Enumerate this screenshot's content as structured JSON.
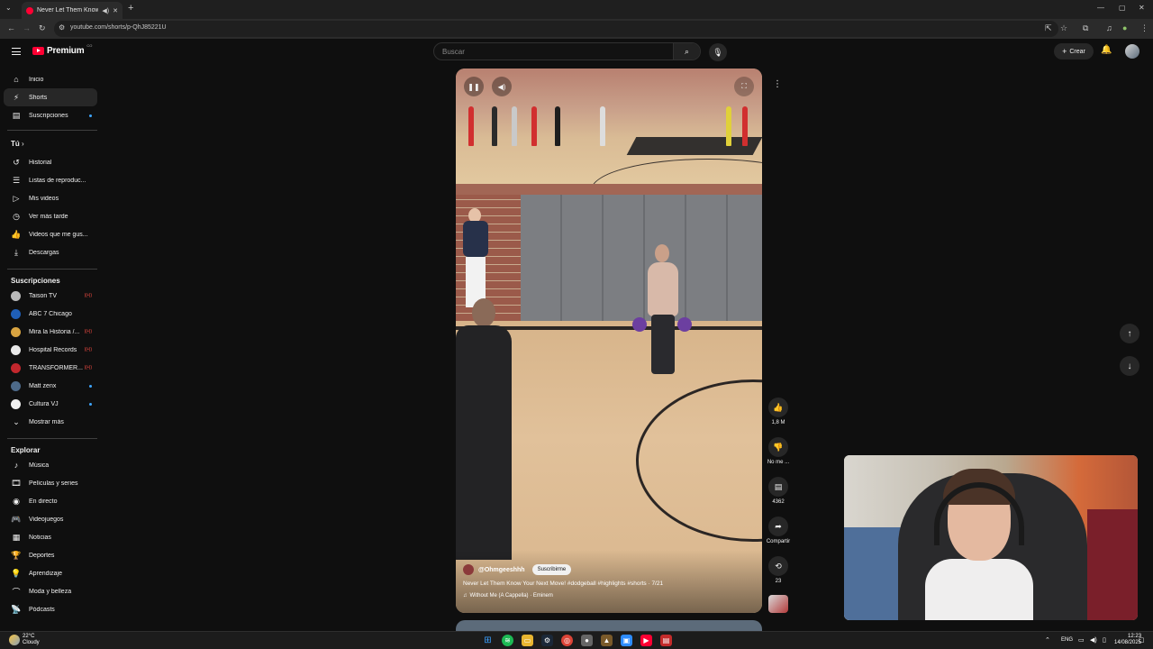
{
  "browser": {
    "tab_title": "Never Let Them Know Your",
    "url": "youtube.com/shorts/p-QhJ85221U",
    "colors": {
      "tab_favicon": "#ff0033"
    }
  },
  "header": {
    "logo_text": "Premium",
    "logo_sup": "CO",
    "search_placeholder": "Buscar",
    "create_label": "Crear"
  },
  "sidebar": {
    "main": [
      {
        "label": "Inicio",
        "icon": "home-icon"
      },
      {
        "label": "Shorts",
        "icon": "shorts-icon",
        "active": true
      },
      {
        "label": "Suscripciones",
        "icon": "subscriptions-icon"
      }
    ],
    "you_heading": "Tú",
    "you": [
      {
        "label": "Historial",
        "icon": "history-icon"
      },
      {
        "label": "Listas de reproduc...",
        "icon": "playlist-icon"
      },
      {
        "label": "Mis videos",
        "icon": "my-videos-icon"
      },
      {
        "label": "Ver más tarde",
        "icon": "watch-later-icon"
      },
      {
        "label": "Videos que me gus...",
        "icon": "liked-icon"
      },
      {
        "label": "Descargas",
        "icon": "download-icon"
      }
    ],
    "subs_heading": "Suscripciones",
    "subs": [
      {
        "label": "Taison TV",
        "color": "#b9b9b9"
      },
      {
        "label": "ABC 7 Chicago",
        "color": "#1f5fb8"
      },
      {
        "label": "Mira la Historia /...",
        "color": "#d9a441"
      },
      {
        "label": "Hospital Records",
        "color": "#e9e9e9"
      },
      {
        "label": "TRANSFORMER...",
        "color": "#c2272d"
      },
      {
        "label": "Matt zenx",
        "color": "#4d6a8a"
      },
      {
        "label": "Cultura VJ",
        "color": "#f0f0f0"
      }
    ],
    "show_more": "Mostrar más",
    "explore_heading": "Explorar",
    "explore": [
      {
        "label": "Música",
        "icon": "music-icon"
      },
      {
        "label": "Películas y series",
        "icon": "movies-icon"
      },
      {
        "label": "En directo",
        "icon": "live-icon"
      },
      {
        "label": "Videojuegos",
        "icon": "gaming-icon"
      },
      {
        "label": "Noticias",
        "icon": "news-icon"
      },
      {
        "label": "Deportes",
        "icon": "sports-icon"
      },
      {
        "label": "Aprendizaje",
        "icon": "learning-icon"
      },
      {
        "label": "Moda y belleza",
        "icon": "fashion-icon"
      },
      {
        "label": "Pódcasts",
        "icon": "podcast-icon"
      }
    ]
  },
  "short": {
    "channel": "@Ohmgeeshhh",
    "subscribe_label": "Suscribirme",
    "title": "Never Let Them Know Your Next Move! #dodgeball #highlights #shorts · 7/21",
    "music": "Without Me (A Cappella) · Eminem",
    "actions": {
      "likes": "1,8 M",
      "dislike": "No me ...",
      "comments": "4362",
      "share": "Compartir",
      "remix": "23"
    }
  },
  "taskbar": {
    "weather_temp": "22°C",
    "weather_desc": "Cloudy",
    "lang": "ENG",
    "time": "12:23",
    "date": "14/08/2025"
  }
}
